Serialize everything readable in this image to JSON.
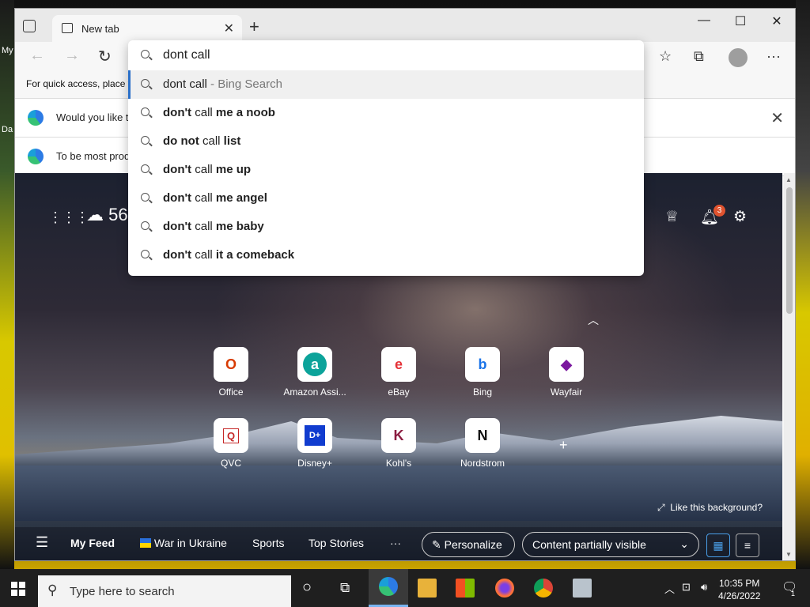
{
  "desktop": {
    "label_top": "My",
    "label_mid": "Da"
  },
  "browser": {
    "tab_title": "New tab",
    "favorites_bar_text": "For quick access, place y",
    "info_bars": [
      {
        "text": "Would you like t"
      },
      {
        "text": "To be most prod"
      }
    ]
  },
  "address_bar": {
    "value": "dont call",
    "suggestions": [
      {
        "prefix": "dont call",
        "suffix": " - Bing Search",
        "type": "search",
        "selected": true
      },
      {
        "prefix": "don't",
        "mid": " call ",
        "suffix": "me a noob"
      },
      {
        "prefix": "do not",
        "mid": " call ",
        "suffix": "list"
      },
      {
        "prefix": "don't",
        "mid": " call ",
        "suffix": "me up"
      },
      {
        "prefix": "don't",
        "mid": " call ",
        "suffix": "me angel"
      },
      {
        "prefix": "don't",
        "mid": " call ",
        "suffix": "me baby"
      },
      {
        "prefix": "don't",
        "mid": " call ",
        "suffix": "it a comeback"
      }
    ]
  },
  "ntp": {
    "weather_temp": "56",
    "notification_count": "3",
    "quick_links": [
      {
        "label": "Office",
        "glyph": "O",
        "color": "#d83b01"
      },
      {
        "label": "Amazon Assi...",
        "glyph": "a",
        "color": "#0ca39a"
      },
      {
        "label": "eBay",
        "glyph": "e",
        "color": "#e53238"
      },
      {
        "label": "Bing",
        "glyph": "b",
        "color": "#1a73e8"
      },
      {
        "label": "Wayfair",
        "glyph": "◆",
        "color": "#7b189f"
      },
      {
        "label": "QVC",
        "glyph": "Q",
        "color": "#c62828"
      },
      {
        "label": "Disney+",
        "glyph": "D+",
        "color": "#113ccf"
      },
      {
        "label": "Kohl's",
        "glyph": "K",
        "color": "#8b1d41"
      },
      {
        "label": "Nordstrom",
        "glyph": "N",
        "color": "#111111"
      }
    ],
    "like_background": "Like this background?",
    "feed": {
      "my_feed": "My Feed",
      "war": "War in Ukraine",
      "sports": "Sports",
      "top_stories": "Top Stories",
      "more": "···",
      "personalize": "Personalize",
      "content_visibility": "Content partially visible"
    }
  },
  "taskbar": {
    "search_placeholder": "Type here to search",
    "time": "10:35 PM",
    "date": "4/26/2022",
    "notifications": "1"
  }
}
